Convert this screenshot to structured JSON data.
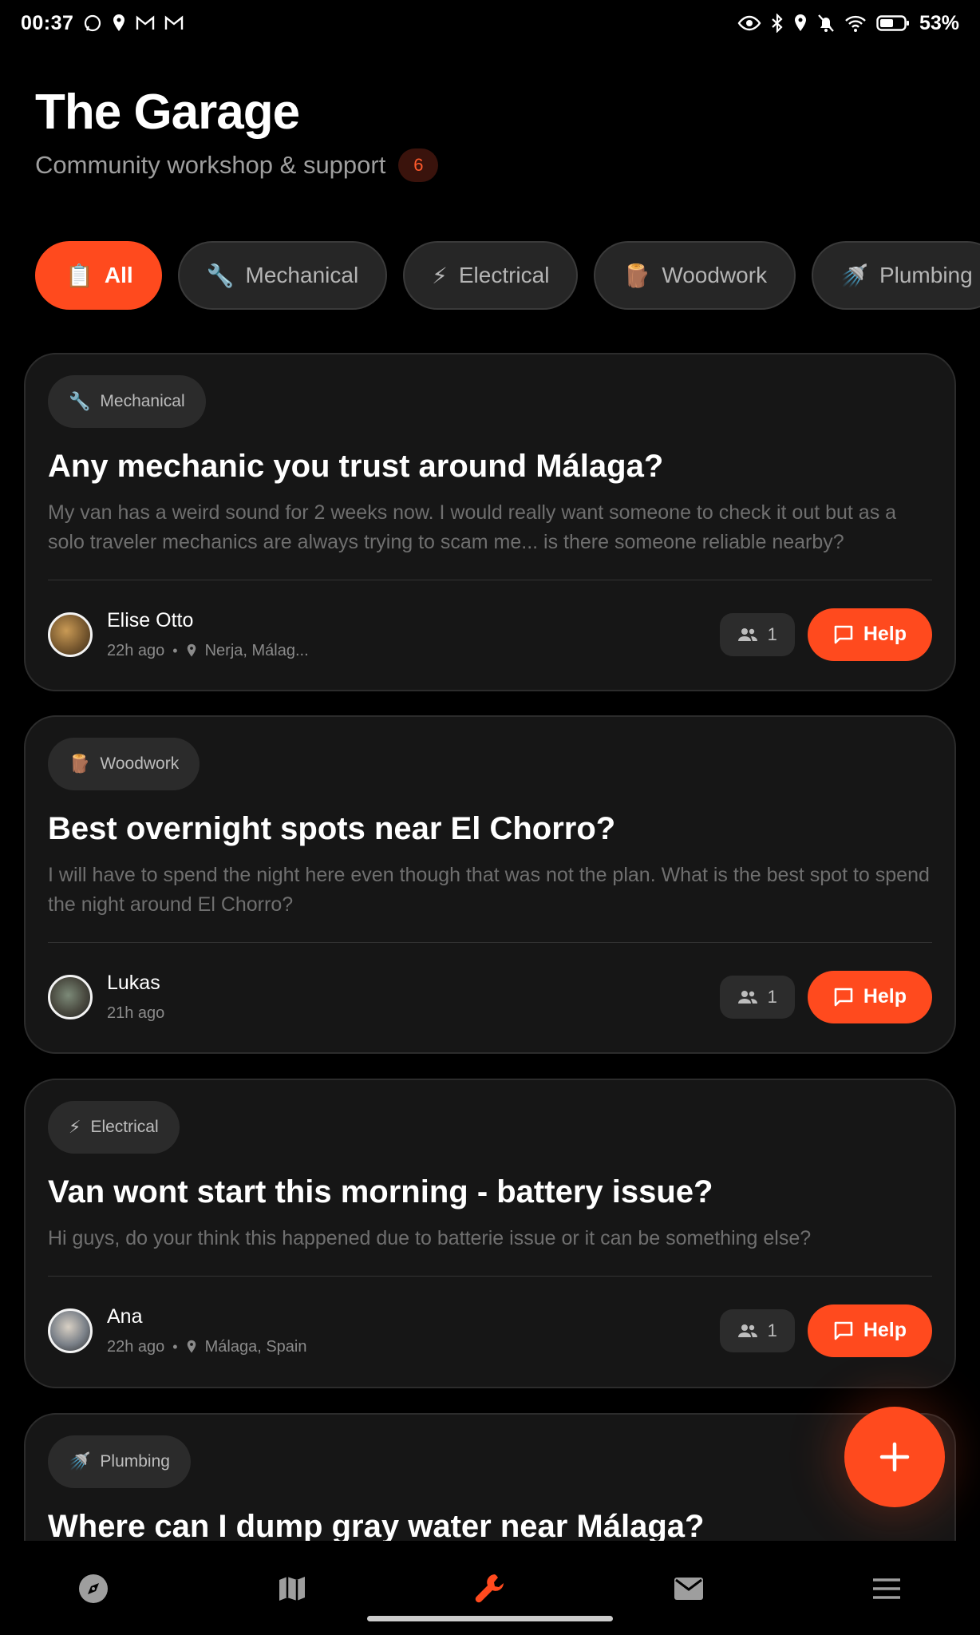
{
  "status_bar": {
    "time": "00:37",
    "battery": "53%"
  },
  "header": {
    "title": "The Garage",
    "subtitle": "Community workshop & support",
    "count": "6"
  },
  "filters": [
    {
      "emoji": "📋",
      "label": "All",
      "active": true
    },
    {
      "emoji": "🔧",
      "label": "Mechanical",
      "active": false
    },
    {
      "emoji": "⚡",
      "label": "Electrical",
      "active": false
    },
    {
      "emoji": "🪵",
      "label": "Woodwork",
      "active": false
    },
    {
      "emoji": "🚿",
      "label": "Plumbing",
      "active": false
    }
  ],
  "posts": [
    {
      "tag_emoji": "🔧",
      "tag": "Mechanical",
      "title": "Any mechanic you trust around Málaga?",
      "body": "My van has a weird sound for 2 weeks now. I would really want someone to check it out but as a solo traveler mechanics are always trying to scam me... is there someone reliable nearby?",
      "author": "Elise Otto",
      "time": "22h ago",
      "location": "Nerja, Málag...",
      "helpers": "1",
      "help_label": "Help"
    },
    {
      "tag_emoji": "🪵",
      "tag": "Woodwork",
      "title": "Best overnight spots near El Chorro?",
      "body": "I will have to spend the night here even though that was not the plan. What is the best spot to spend the night around El Chorro?",
      "author": "Lukas",
      "time": "21h ago",
      "location": "",
      "helpers": "1",
      "help_label": "Help"
    },
    {
      "tag_emoji": "⚡",
      "tag": "Electrical",
      "title": "Van wont start this morning - battery issue?",
      "body": "Hi guys, do your think this happened due to batterie issue or it can be something else?",
      "author": "Ana",
      "time": "22h ago",
      "location": "Málaga, Spain",
      "helpers": "1",
      "help_label": "Help"
    },
    {
      "tag_emoji": "🚿",
      "tag": "Plumbing",
      "title": "Where can I dump gray water near Málaga?"
    }
  ],
  "nav": [
    "compass-icon",
    "map-icon",
    "wrench-icon",
    "mail-icon",
    "menu-icon"
  ],
  "colors": {
    "accent": "#ff4a1e",
    "background": "#000000",
    "card": "#161616"
  }
}
